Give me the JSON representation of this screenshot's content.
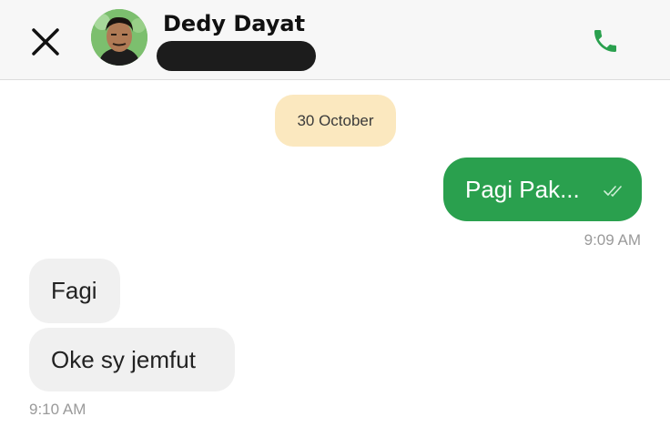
{
  "header": {
    "contact_name": "Dedy Dayat",
    "close_icon": "close-icon",
    "call_icon": "phone-icon",
    "call_color": "#2aa04e"
  },
  "conversation": {
    "date_label": "30 October",
    "outgoing": [
      {
        "text": "Pagi Pak...",
        "time": "9:09 AM",
        "status_icon": "double-check-icon"
      }
    ],
    "incoming": [
      {
        "text": "Fagi"
      },
      {
        "text": "Oke sy jemfut"
      }
    ],
    "incoming_time": "9:10 AM"
  },
  "colors": {
    "outgoing_bubble": "#2aa04e",
    "incoming_bubble": "#f0f0f0",
    "date_pill": "#fbe8bf",
    "header_bg": "#f7f7f7"
  }
}
